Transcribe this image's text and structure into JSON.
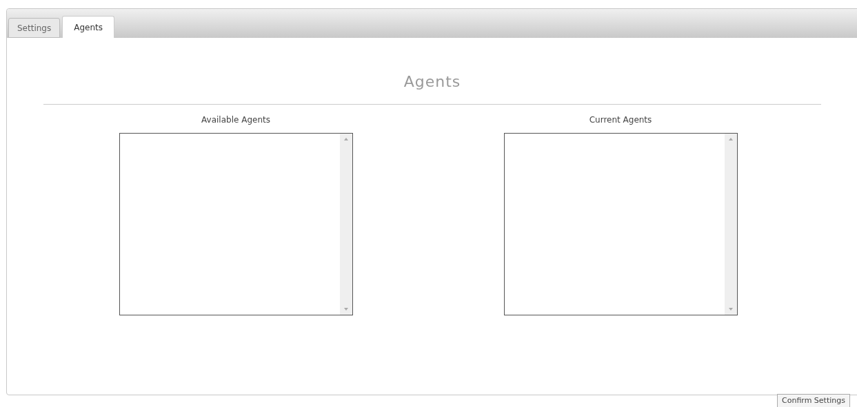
{
  "tabs": [
    {
      "label": "Settings",
      "selected": false
    },
    {
      "label": "Agents",
      "selected": true
    }
  ],
  "heading": "Agents",
  "lists": [
    {
      "label": "Available Agents"
    },
    {
      "label": "Current Agents"
    }
  ],
  "confirm_button": "Confirm Settings"
}
